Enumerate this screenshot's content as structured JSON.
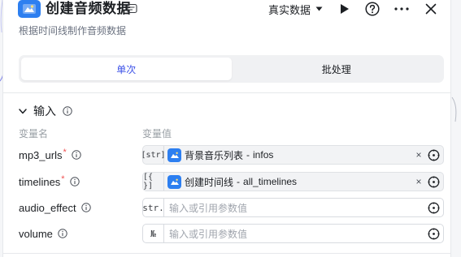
{
  "header": {
    "title": "创建音频数据",
    "subtitle": "根据时间线制作音频数据",
    "mode_label": "真实数据",
    "icons": [
      "app-icon",
      "badge-icon",
      "caret-down-icon",
      "play-icon",
      "help-icon",
      "more-icon",
      "close-icon"
    ]
  },
  "tabs": [
    {
      "label": "单次",
      "active": true
    },
    {
      "label": "批处理",
      "active": false
    }
  ],
  "input_section": {
    "title": "输入",
    "col_name": "变量名",
    "col_value": "变量值",
    "rows": [
      {
        "name": "mp3_urls",
        "required": "*",
        "type_tag": "[str]",
        "ref_source": "背景音乐列表",
        "ref_sep": " - ",
        "ref_field": "infos",
        "placeholder": ""
      },
      {
        "name": "timelines",
        "required": "*",
        "type_tag": "[{ }]",
        "ref_source": "创建时间线",
        "ref_sep": " - ",
        "ref_field": "all_timelines",
        "placeholder": ""
      },
      {
        "name": "audio_effect",
        "required": "",
        "type_tag": "str.",
        "ref_source": "",
        "ref_sep": "",
        "ref_field": "",
        "placeholder": "输入或引用参数值"
      },
      {
        "name": "volume",
        "required": "",
        "type_tag": "№",
        "ref_source": "",
        "ref_sep": "",
        "ref_field": "",
        "placeholder": "输入或引用参数值"
      }
    ]
  },
  "clear_glyph": "×",
  "colors": {
    "accent": "#3f54e8",
    "icon_blue": "#2d7ff0",
    "required": "#f05252"
  }
}
